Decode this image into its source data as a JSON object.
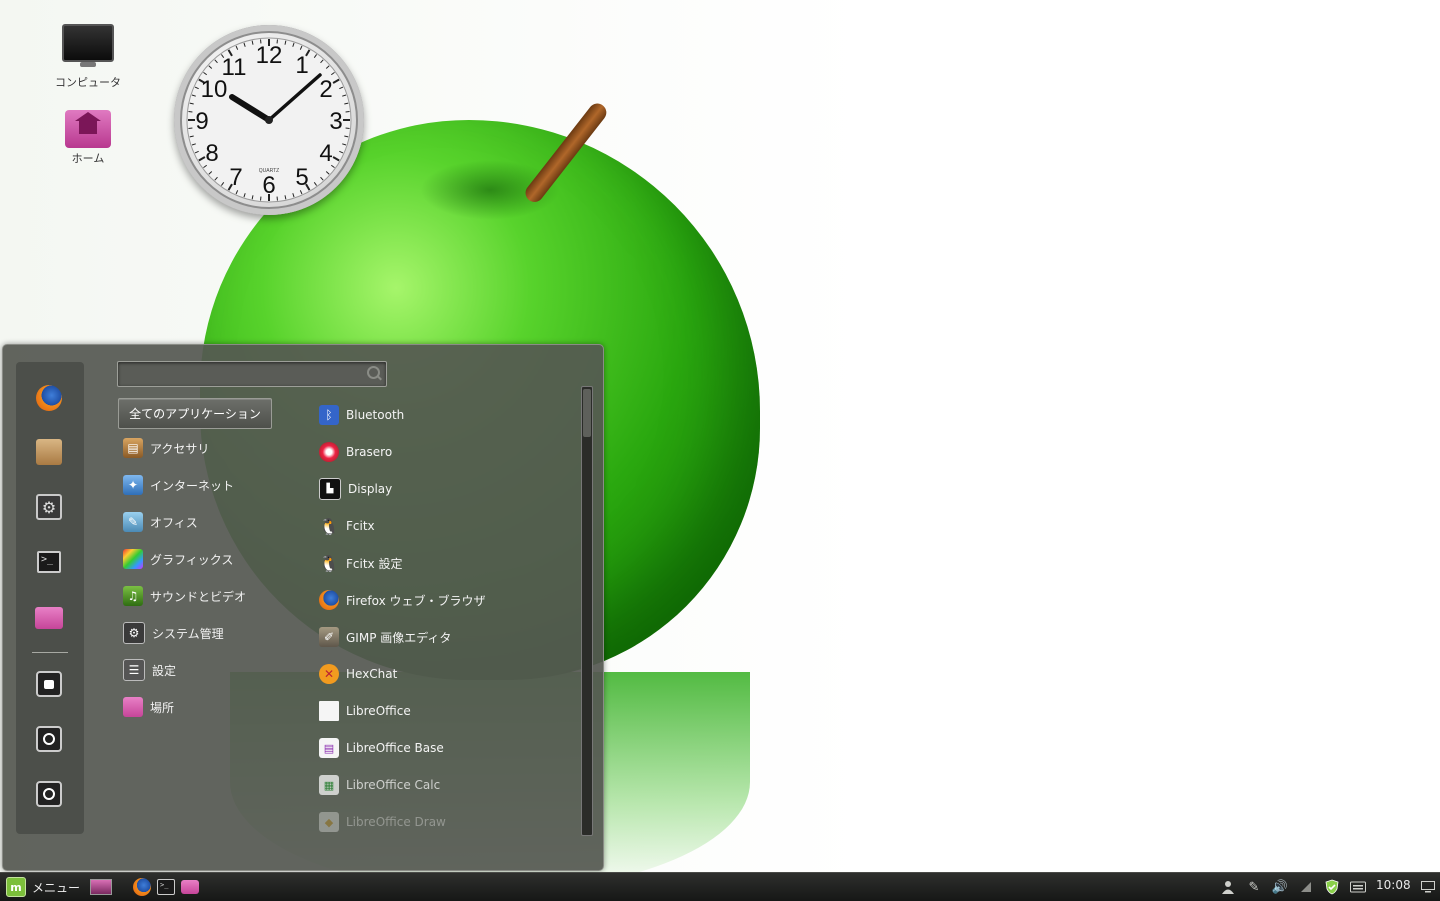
{
  "desktop": {
    "icons": [
      {
        "label": "コンピュータ"
      },
      {
        "label": "ホーム"
      }
    ],
    "clock": {
      "numbers": [
        "12",
        "1",
        "2",
        "3",
        "4",
        "5",
        "6",
        "7",
        "8",
        "9",
        "10",
        "11"
      ],
      "brand": "QUARTZ"
    }
  },
  "menu": {
    "search": {
      "placeholder": ""
    },
    "favorites": [
      "firefox-icon",
      "package-icon",
      "system-settings-icon",
      "terminal-icon",
      "folder-icon",
      "lock-icon",
      "logout-icon",
      "power-icon"
    ],
    "categories": {
      "all": "全てのアプリケーション",
      "items": [
        {
          "label": "アクセサリ",
          "icon": "accessories-icon"
        },
        {
          "label": "インターネット",
          "icon": "internet-icon"
        },
        {
          "label": "オフィス",
          "icon": "office-icon"
        },
        {
          "label": "グラフィックス",
          "icon": "graphics-icon"
        },
        {
          "label": "サウンドとビデオ",
          "icon": "sound-video-icon"
        },
        {
          "label": "システム管理",
          "icon": "system-admin-icon"
        },
        {
          "label": "設定",
          "icon": "settings-icon"
        },
        {
          "label": "場所",
          "icon": "places-icon"
        }
      ]
    },
    "apps": [
      {
        "label": "Bluetooth",
        "icon": "bluetooth-icon"
      },
      {
        "label": "Brasero",
        "icon": "brasero-icon"
      },
      {
        "label": "Display",
        "icon": "display-icon"
      },
      {
        "label": "Fcitx",
        "icon": "fcitx-icon"
      },
      {
        "label": "Fcitx 設定",
        "icon": "fcitx-settings-icon"
      },
      {
        "label": "Firefox ウェブ・ブラウザ",
        "icon": "firefox-icon"
      },
      {
        "label": "GIMP 画像エディタ",
        "icon": "gimp-icon"
      },
      {
        "label": "HexChat",
        "icon": "hexchat-icon"
      },
      {
        "label": "LibreOffice",
        "icon": "libreoffice-icon"
      },
      {
        "label": "LibreOffice Base",
        "icon": "libreoffice-base-icon"
      },
      {
        "label": "LibreOffice Calc",
        "icon": "libreoffice-calc-icon"
      },
      {
        "label": "LibreOffice Draw",
        "icon": "libreoffice-draw-icon"
      }
    ]
  },
  "taskbar": {
    "menu_label": "メニュー",
    "launchers": [
      "desktop-icon",
      "firefox-icon",
      "terminal-icon",
      "folder-icon"
    ],
    "tray": [
      "user-icon",
      "pen-icon",
      "volume-icon",
      "network-icon",
      "shield-icon",
      "keyboard-icon",
      "workspace-icon"
    ],
    "time": "10:08"
  }
}
